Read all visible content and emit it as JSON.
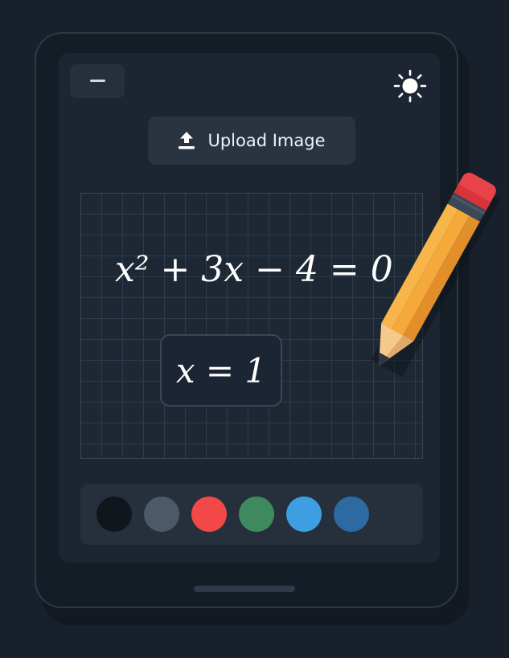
{
  "toolbar": {
    "menu_icon": "minus-icon",
    "theme_icon": "sun-icon"
  },
  "upload": {
    "label": "Upload Image",
    "icon": "upload-icon"
  },
  "canvas": {
    "equation": "x² + 3x − 4 = 0",
    "result": "x = 1"
  },
  "palette": {
    "colors": [
      "#11161d",
      "#4b5968",
      "#f24848",
      "#3e8a5e",
      "#3d9ee1",
      "#2d6aa1"
    ]
  },
  "decoration": {
    "pencil_icon": "pencil-icon"
  }
}
